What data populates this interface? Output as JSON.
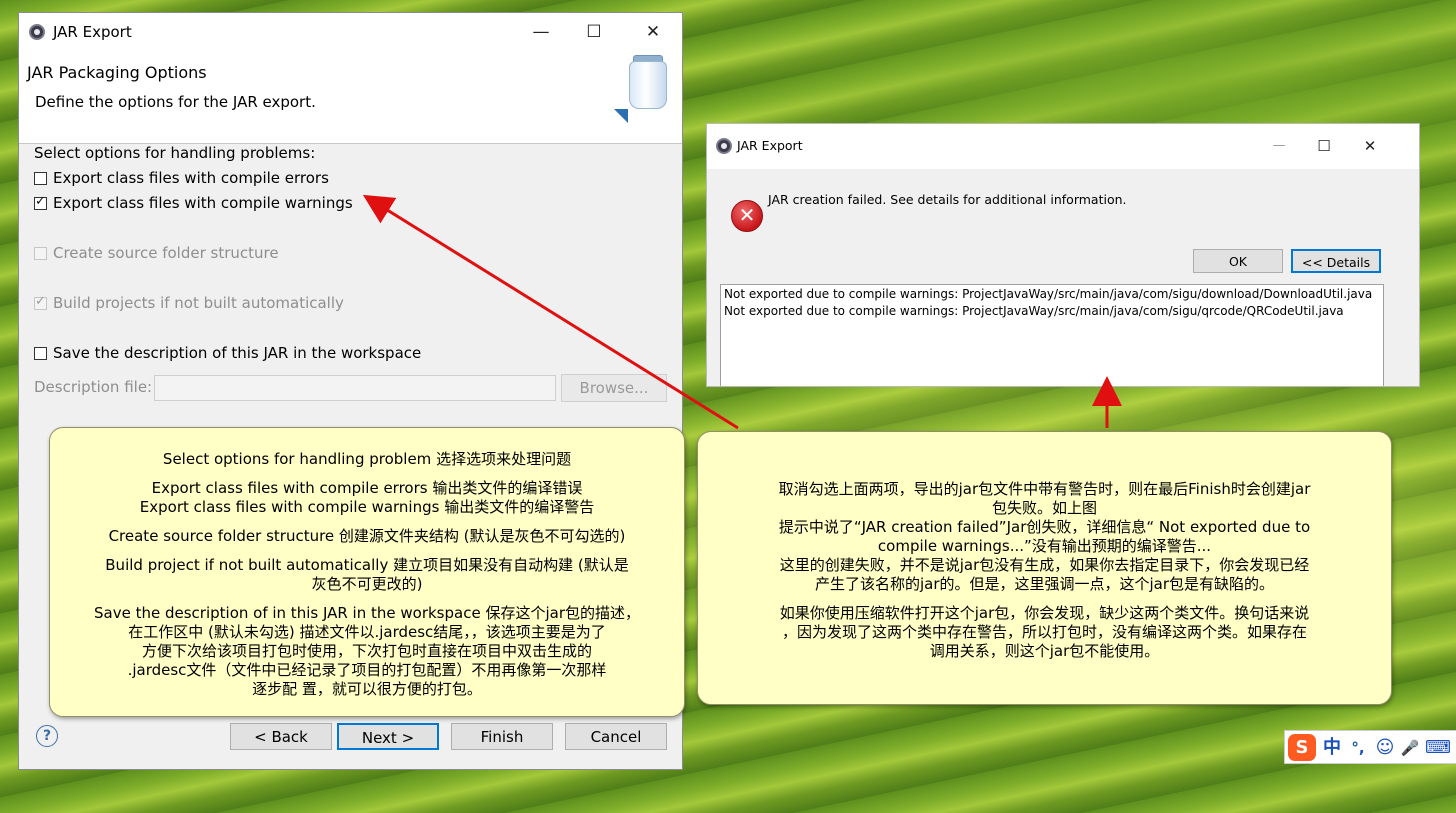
{
  "main_dialog": {
    "title": "JAR Export",
    "page_title": "JAR Packaging Options",
    "page_subtitle": "Define the options for the JAR export.",
    "section_label": "Select options for handling problems:",
    "options": {
      "compile_errors": "Export class files with compile errors",
      "compile_warnings": "Export class files with compile warnings",
      "source_folder": "Create source folder structure",
      "build_projects": "Build projects if not built automatically",
      "save_description": "Save the description of this JAR in the workspace"
    },
    "description_file_label": "Description file:",
    "browse_label": "Browse...",
    "buttons": {
      "back": "< Back",
      "next": "Next >",
      "finish": "Finish",
      "cancel": "Cancel"
    },
    "help_symbol": "?"
  },
  "error_dialog": {
    "title": "JAR Export",
    "message": "JAR creation failed. See details for additional information.",
    "ok_label": "OK",
    "details_label": "<< Details",
    "details_lines": [
      "Not exported due to compile warnings: ProjectJavaWay/src/main/java/com/sigu/download/DownloadUtil.java",
      "Not exported due to compile warnings: ProjectJavaWay/src/main/java/com/sigu/qrcode/QRCodeUtil.java"
    ]
  },
  "window_controls": {
    "minimize": "—",
    "maximize": "☐",
    "close": "✕"
  },
  "callout_left": {
    "lines": [
      "Select options for handling problem 选择选项来处理问题",
      "Export class files with compile errors 输出类文件的编译错误",
      "Export class files with compile warnings 输出类文件的编译警告",
      "Create source folder structure 创建源文件夹结构 (默认是灰色不可勾选的)",
      "Build project if not built automatically 建立项目如果没有自动构建 (默认是",
      "灰色不可更改的)",
      "Save the description of in this JAR in the workspace 保存这个jar包的描述，",
      "在工作区中 (默认未勾选) 描述文件以.jardesc结尾，，该选项主要是为了",
      "方便下次给该项目打包时使用，下次打包时直接在项目中双击生成的",
      ".jardesc文件（文件中已经记录了项目的打包配置）不用再像第一次那样",
      "逐步配   置，就可以很方便的打包。"
    ]
  },
  "callout_right": {
    "lines": [
      "取消勾选上面两项，导出的jar包文件中带有警告时，则在最后Finish时会创建jar",
      "包失败。如上图",
      "提示中说了“JAR creation failed”Jar创失败，详细信息“ Not exported due to",
      "compile warnings...”没有输出预期的编译警告...",
      "这里的创建失败，并不是说jar包没有生成，如果你去指定目录下，你会发现已经",
      "产生了该名称的jar的。但是，这里强调一点，这个jar包是有缺陷的。",
      "如果你使用压缩软件打开这个jar包，你会发现，缺少这两个类文件。换句话来说",
      "，因为发现了这两个类中存在警告，所以打包时，没有编译这两个类。如果存在",
      "调用关系，则这个jar包不能使用。"
    ]
  },
  "ime_bar": {
    "logo": "S",
    "mode": "中",
    "punct": "°,",
    "emoji": "☺",
    "mic": "🎤",
    "keyboard": "⌨"
  },
  "colors": {
    "arrow": "#e01010",
    "callout_bg": "#ffffc6",
    "default_button_border": "#0078d7"
  }
}
